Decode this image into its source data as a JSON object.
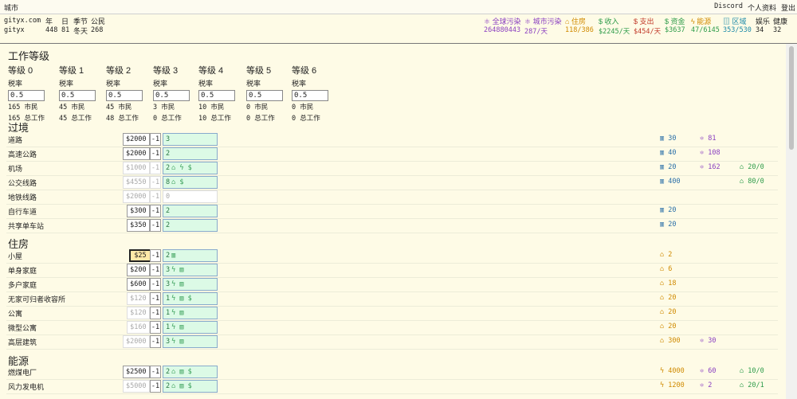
{
  "topbar": {
    "title": "城市",
    "discord": "Discord",
    "profile": "个人资料",
    "logout": "登出"
  },
  "stats": {
    "site": "gityx.com",
    "city": "gityx",
    "year_label": "年",
    "year": "448",
    "day_label": "日",
    "day": "81",
    "season_label": "季节",
    "season": "冬天",
    "citizens_label": "公民",
    "citizens": "268",
    "global_pollution_label": "全球污染",
    "global_pollution": "264880443",
    "city_pollution_label": "城市污染",
    "city_pollution": "287/天",
    "housing_label": "住房",
    "housing": "118/386",
    "income_label": "收入",
    "income": "$2245/天",
    "expense_label": "支出",
    "expense": "$454/天",
    "funds_label": "资金",
    "funds": "$3637",
    "energy_label": "能源",
    "energy": "47/6145",
    "area_label": "区域",
    "area": "353/530",
    "fun_label": "娱乐",
    "fun": "34",
    "health_label": "健康",
    "health": "32"
  },
  "work_levels": {
    "title": "工作等级",
    "tax_label": "税率",
    "citizens_suffix": "市民",
    "jobs_suffix": "总工作",
    "levels": [
      {
        "name": "等级 0",
        "tax": "0.5",
        "citizens": "165",
        "jobs": "165"
      },
      {
        "name": "等级 1",
        "tax": "0.5",
        "citizens": "45",
        "jobs": "45"
      },
      {
        "name": "等级 2",
        "tax": "0.5",
        "citizens": "45",
        "jobs": "48"
      },
      {
        "name": "等级 3",
        "tax": "0.5",
        "citizens": "3",
        "jobs": "0"
      },
      {
        "name": "等级 4",
        "tax": "0.5",
        "citizens": "10",
        "jobs": "10"
      },
      {
        "name": "等级 5",
        "tax": "0.5",
        "citizens": "0",
        "jobs": "0"
      },
      {
        "name": "等级 6",
        "tax": "0.5",
        "citizens": "0",
        "jobs": "0"
      }
    ]
  },
  "sections": {
    "transit": "过境",
    "housing": "住房",
    "energy": "能源"
  },
  "minus_label": "-1",
  "transit_rows": [
    {
      "name": "道路",
      "cost": "$2000",
      "count": "3",
      "icons": "",
      "area": "30",
      "pop": "81",
      "cap": ""
    },
    {
      "name": "高速公路",
      "cost": "$2000",
      "count": "2",
      "icons": "",
      "area": "40",
      "pop": "108",
      "cap": ""
    },
    {
      "name": "机场",
      "cost": "$1000",
      "count": "2",
      "icons": "⌂ ϟ $",
      "area": "20",
      "pop": "162",
      "cap": "20/0"
    },
    {
      "name": "公交线路",
      "cost": "$4550",
      "count": "8",
      "icons": "⌂ $",
      "area": "400",
      "pop": "",
      "cap": "80/0"
    },
    {
      "name": "地铁线路",
      "cost": "$2000",
      "count": "0",
      "icons": "",
      "area": "",
      "pop": "",
      "cap": ""
    },
    {
      "name": "自行车道",
      "cost": "$300",
      "count": "2",
      "icons": "",
      "area": "20",
      "pop": "",
      "cap": ""
    },
    {
      "name": "共享单车站",
      "cost": "$350",
      "count": "2",
      "icons": "",
      "area": "20",
      "pop": "",
      "cap": ""
    }
  ],
  "housing_rows": [
    {
      "name": "小屋",
      "cost": "$25",
      "count": "2",
      "icons": "▥",
      "housing": "2",
      "pop": ""
    },
    {
      "name": "单身家庭",
      "cost": "$200",
      "count": "3",
      "icons": "ϟ ▥",
      "housing": "6",
      "pop": ""
    },
    {
      "name": "多户家庭",
      "cost": "$600",
      "count": "3",
      "icons": "ϟ ▥",
      "housing": "18",
      "pop": ""
    },
    {
      "name": "无家可归者收容所",
      "cost": "$120",
      "count": "1",
      "icons": "ϟ ▥ $",
      "housing": "20",
      "pop": ""
    },
    {
      "name": "公寓",
      "cost": "$120",
      "count": "1",
      "icons": "ϟ ▥",
      "housing": "20",
      "pop": ""
    },
    {
      "name": "微型公寓",
      "cost": "$160",
      "count": "1",
      "icons": "ϟ ▥",
      "housing": "20",
      "pop": ""
    },
    {
      "name": "高层建筑",
      "cost": "$2000",
      "count": "3",
      "icons": "ϟ ▥",
      "housing": "300",
      "pop": "30"
    }
  ],
  "energy_rows": [
    {
      "name": "燃煤电厂",
      "cost": "$2500",
      "count": "2",
      "icons": "⌂ ▥ $",
      "energy": "4000",
      "pop": "60",
      "cap": "10/0"
    },
    {
      "name": "风力发电机",
      "cost": "$5000",
      "count": "2",
      "icons": "⌂ ▥ $",
      "energy": "1200",
      "pop": "2",
      "cap": "20/1"
    }
  ]
}
